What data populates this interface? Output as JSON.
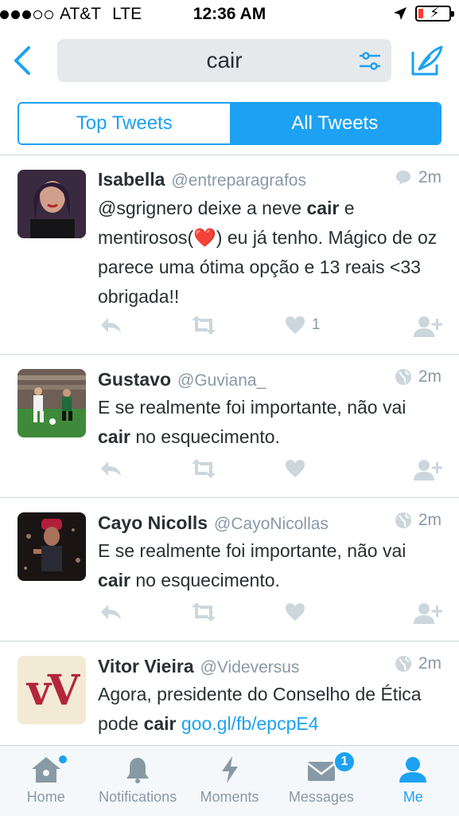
{
  "status_bar": {
    "carrier": "AT&T",
    "network": "LTE",
    "time": "12:36 AM"
  },
  "nav": {
    "search_query": "cair"
  },
  "segments": [
    {
      "label": "Top Tweets",
      "active": false
    },
    {
      "label": "All Tweets",
      "active": true
    }
  ],
  "tweets": [
    {
      "name": "Isabella",
      "handle": "@entreparagrafos",
      "time": "2m",
      "meta_icon": "reply-bubble-icon",
      "text_before": "@sgrignero deixe a neve ",
      "text_bold": "cair",
      "text_after": " e mentirosos(",
      "emoji": "❤️",
      "text_after2": ") eu já tenho. Mágico de oz parece uma ótima opção e 13 reais <33 obrigada!!",
      "like_count": "1"
    },
    {
      "name": "Gustavo",
      "handle": "@Guviana_",
      "time": "2m",
      "meta_icon": "globe-icon",
      "text_before": "E se realmente foi importante, não vai ",
      "text_bold": "cair",
      "text_after": " no esquecimento."
    },
    {
      "name": "Cayo Nicolls",
      "handle": "@CayoNicollas",
      "time": "2m",
      "meta_icon": "globe-icon",
      "text_before": "E se realmente foi importante, não vai ",
      "text_bold": "cair",
      "text_after": " no esquecimento."
    },
    {
      "name": "Vitor Vieira",
      "handle": "@Videversus",
      "time": "2m",
      "meta_icon": "globe-icon",
      "text_before": "Agora, presidente do Conselho de Ética pode ",
      "text_bold": "cair",
      "text_after": " ",
      "link": "goo.gl/fb/epcpE4",
      "avatar_text": "vV"
    }
  ],
  "tabbar": {
    "home": "Home",
    "notifications": "Notifications",
    "moments": "Moments",
    "messages": "Messages",
    "messages_badge": "1",
    "me": "Me"
  },
  "colors": {
    "accent": "#1da1f2",
    "muted": "#8899a6",
    "text": "#292f33"
  }
}
